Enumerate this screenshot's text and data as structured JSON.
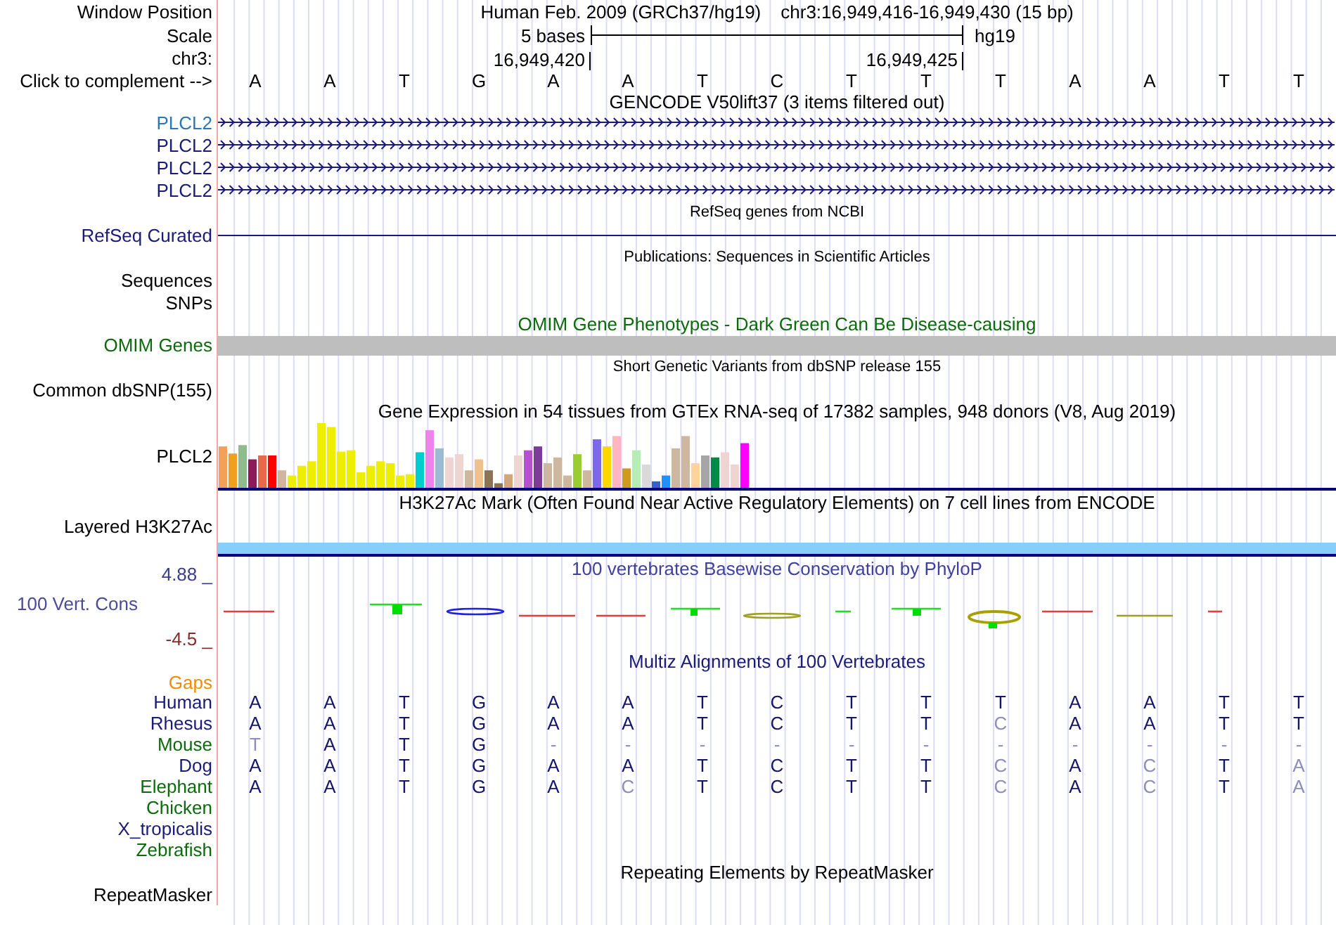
{
  "header": {
    "position_label": "Window Position",
    "assembly": "Human Feb. 2009 (GRCh37/hg19)",
    "range": "chr3:16,949,416-16,949,430 (15 bp)",
    "scale_label": "Scale",
    "scale_text": "5 bases",
    "scale_assembly": "hg19",
    "chrom_label": "chr3:",
    "ticks": [
      "16,949,420",
      "16,949,425"
    ],
    "complement_label": "Click to complement -->",
    "bases": [
      "A",
      "A",
      "T",
      "G",
      "A",
      "A",
      "T",
      "C",
      "T",
      "T",
      "T",
      "A",
      "A",
      "T",
      "T"
    ]
  },
  "tracks": [
    {
      "kind": "genes",
      "title": "GENCODE V50lift37 (3 items filtered out)",
      "items": [
        {
          "label": "PLCL2",
          "color": "#2878b8"
        },
        {
          "label": "PLCL2",
          "color": "#1a1a7a"
        },
        {
          "label": "PLCL2",
          "color": "#1a1a7a"
        },
        {
          "label": "PLCL2",
          "color": "#1a1a7a"
        }
      ]
    },
    {
      "kind": "line",
      "title": "RefSeq genes from NCBI",
      "label": "RefSeq Curated"
    },
    {
      "kind": "labels",
      "title": "Publications: Sequences in Scientific Articles",
      "labels": [
        "Sequences",
        "SNPs"
      ]
    },
    {
      "kind": "dense",
      "title": "OMIM Gene Phenotypes - Dark Green Can Be Disease-causing",
      "label": "OMIM Genes"
    },
    {
      "kind": "labels",
      "title": "Short Genetic Variants from dbSNP release 155",
      "labels": [
        "Common dbSNP(155)"
      ]
    },
    {
      "kind": "expression",
      "title": "Gene Expression in 54 tissues from GTEx RNA-seq of 17382 samples, 948 donors (V8, Aug 2019)",
      "label": "PLCL2"
    },
    {
      "kind": "signal",
      "title": "H3K27Ac Mark (Often Found Near Active Regulatory Elements) on 7 cell lines from ENCODE",
      "label": "Layered H3K27Ac"
    },
    {
      "kind": "wiggle",
      "title": "100 vertebrates Basewise Conservation by PhyloP",
      "max": "4.88 _",
      "label": "100 Vert. Cons",
      "min": "-4.5 _"
    },
    {
      "kind": "alignment",
      "title": "Multiz Alignments of 100 Vertebrates",
      "gaps_label": "Gaps",
      "species": [
        {
          "name": "Human",
          "color": "#1a1a7a",
          "bases": [
            {
              "b": "A",
              "faded": false
            },
            {
              "b": "A",
              "faded": false
            },
            {
              "b": "T",
              "faded": false
            },
            {
              "b": "G",
              "faded": false
            },
            {
              "b": "A",
              "faded": false
            },
            {
              "b": "A",
              "faded": false
            },
            {
              "b": "T",
              "faded": false
            },
            {
              "b": "C",
              "faded": false
            },
            {
              "b": "T",
              "faded": false
            },
            {
              "b": "T",
              "faded": false
            },
            {
              "b": "T",
              "faded": false
            },
            {
              "b": "A",
              "faded": false
            },
            {
              "b": "A",
              "faded": false
            },
            {
              "b": "T",
              "faded": false
            },
            {
              "b": "T",
              "faded": false
            }
          ]
        },
        {
          "name": "Rhesus",
          "color": "#1a1a7a",
          "bases": [
            {
              "b": "A",
              "faded": false
            },
            {
              "b": "A",
              "faded": false
            },
            {
              "b": "T",
              "faded": false
            },
            {
              "b": "G",
              "faded": false
            },
            {
              "b": "A",
              "faded": false
            },
            {
              "b": "A",
              "faded": false
            },
            {
              "b": "T",
              "faded": false
            },
            {
              "b": "C",
              "faded": false
            },
            {
              "b": "T",
              "faded": false
            },
            {
              "b": "T",
              "faded": false
            },
            {
              "b": "C",
              "faded": true
            },
            {
              "b": "A",
              "faded": false
            },
            {
              "b": "A",
              "faded": false
            },
            {
              "b": "T",
              "faded": false
            },
            {
              "b": "T",
              "faded": false
            }
          ]
        },
        {
          "name": "Mouse",
          "color": "#0b6b0b",
          "bases": [
            {
              "b": "T",
              "faded": true
            },
            {
              "b": "A",
              "faded": false
            },
            {
              "b": "T",
              "faded": false
            },
            {
              "b": "G",
              "faded": false
            },
            {
              "b": "-",
              "faded": true
            },
            {
              "b": "-",
              "faded": true
            },
            {
              "b": "-",
              "faded": true
            },
            {
              "b": "-",
              "faded": true
            },
            {
              "b": "-",
              "faded": true
            },
            {
              "b": "-",
              "faded": true
            },
            {
              "b": "-",
              "faded": true
            },
            {
              "b": "-",
              "faded": true
            },
            {
              "b": "-",
              "faded": true
            },
            {
              "b": "-",
              "faded": true
            },
            {
              "b": "-",
              "faded": true
            }
          ]
        },
        {
          "name": "Dog",
          "color": "#1a1a7a",
          "bases": [
            {
              "b": "A",
              "faded": false
            },
            {
              "b": "A",
              "faded": false
            },
            {
              "b": "T",
              "faded": false
            },
            {
              "b": "G",
              "faded": false
            },
            {
              "b": "A",
              "faded": false
            },
            {
              "b": "A",
              "faded": false
            },
            {
              "b": "T",
              "faded": false
            },
            {
              "b": "C",
              "faded": false
            },
            {
              "b": "T",
              "faded": false
            },
            {
              "b": "T",
              "faded": false
            },
            {
              "b": "C",
              "faded": true
            },
            {
              "b": "A",
              "faded": false
            },
            {
              "b": "C",
              "faded": true
            },
            {
              "b": "T",
              "faded": false
            },
            {
              "b": "A",
              "faded": true
            }
          ]
        },
        {
          "name": "Elephant",
          "color": "#0b6b0b",
          "bases": [
            {
              "b": "A",
              "faded": false
            },
            {
              "b": "A",
              "faded": false
            },
            {
              "b": "T",
              "faded": false
            },
            {
              "b": "G",
              "faded": false
            },
            {
              "b": "A",
              "faded": false
            },
            {
              "b": "C",
              "faded": true
            },
            {
              "b": "T",
              "faded": false
            },
            {
              "b": "C",
              "faded": false
            },
            {
              "b": "T",
              "faded": false
            },
            {
              "b": "T",
              "faded": false
            },
            {
              "b": "C",
              "faded": true
            },
            {
              "b": "A",
              "faded": false
            },
            {
              "b": "C",
              "faded": true
            },
            {
              "b": "T",
              "faded": false
            },
            {
              "b": "A",
              "faded": true
            }
          ]
        },
        {
          "name": "Chicken",
          "color": "#0b6b0b"
        },
        {
          "name": "X_tropicalis",
          "color": "#1a1a7a"
        },
        {
          "name": "Zebrafish",
          "color": "#0b6b0b"
        }
      ]
    },
    {
      "kind": "repeat",
      "title": "Repeating Elements by RepeatMasker",
      "labels": [
        "RepeatMasker"
      ]
    }
  ]
}
